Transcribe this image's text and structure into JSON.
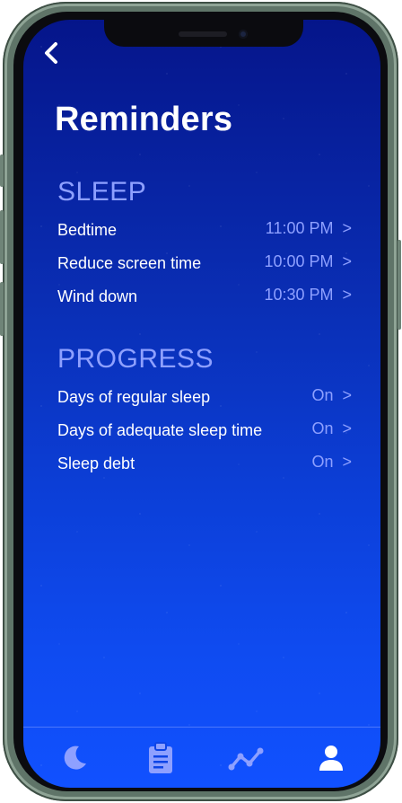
{
  "header": {
    "back_icon": "chevron-left-icon",
    "back_glyph": "<",
    "title": "Reminders"
  },
  "sections": [
    {
      "title": "SLEEP",
      "items": [
        {
          "label": "Bedtime",
          "value": "11:00 PM",
          "chevron": ">"
        },
        {
          "label": "Reduce screen time",
          "value": "10:00 PM",
          "chevron": ">"
        },
        {
          "label": "Wind down",
          "value": "10:30 PM",
          "chevron": ">"
        }
      ]
    },
    {
      "title": "PROGRESS",
      "items": [
        {
          "label": "Days of regular sleep",
          "value": "On",
          "chevron": ">"
        },
        {
          "label": "Days of adequate sleep time",
          "value": "On",
          "chevron": ">"
        },
        {
          "label": "Sleep debt",
          "value": "On",
          "chevron": ">"
        }
      ]
    }
  ],
  "tab_bar": {
    "tabs": [
      {
        "icon": "moon-icon",
        "active": false
      },
      {
        "icon": "clipboard-icon",
        "active": false
      },
      {
        "icon": "trend-line-icon",
        "active": false
      },
      {
        "icon": "user-icon",
        "active": true
      }
    ]
  },
  "colors": {
    "accent": "#8ea0ff",
    "background_top": "#05158a",
    "background_bottom": "#1151ff",
    "text": "#ffffff",
    "inactive_tab": "#8ea0ff"
  }
}
